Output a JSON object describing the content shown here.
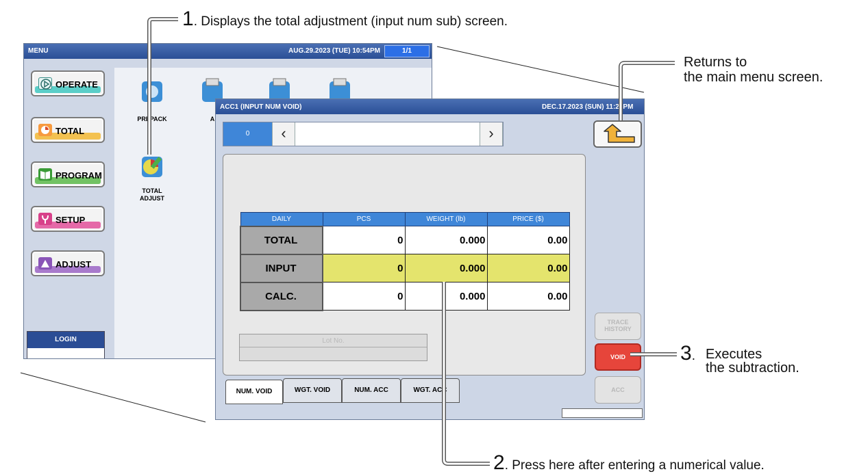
{
  "callouts": {
    "c1_num": "1",
    "c1_text": "Displays the total adjustment (input num sub) screen.",
    "c2_num": "2",
    "c2_text": "Press here after entering a numerical value.",
    "c3_num": "3",
    "c3_line1": "Executes",
    "c3_line2": "the subtraction.",
    "back_line1": "Returns to",
    "back_line2": "the main menu screen."
  },
  "menu_screen": {
    "title": "MENU",
    "date": "AUG.29.2023 (TUE)  10:54PM",
    "page": "1/1",
    "buttons": [
      {
        "label": "OPERATE",
        "color": "#3fc7c0"
      },
      {
        "label": "TOTAL",
        "color": "#f2b733"
      },
      {
        "label": "PROGRAM",
        "color": "#5ab84a"
      },
      {
        "label": "SETUP",
        "color": "#e2509a"
      },
      {
        "label": "ADJUST",
        "color": "#9a64c4"
      }
    ],
    "login_label": "LOGIN",
    "grid": {
      "prepack_label": "PREPACK",
      "acc_label": "A",
      "total_adjust_label_1": "TOTAL",
      "total_adjust_label_2": "ADJUST"
    }
  },
  "acc_screen": {
    "title": "ACC1 (INPUT NUM VOID)",
    "date": "DEC.17.2023 (SUN)  11:28PM",
    "index": "0",
    "columns": [
      "DAILY",
      "PCS",
      "WEIGHT (lb)",
      "PRICE ($)"
    ],
    "rows": [
      {
        "label": "TOTAL",
        "pcs": "0",
        "weight": "0.000",
        "price": "0.00"
      },
      {
        "label": "INPUT",
        "pcs": "0",
        "weight": "0.000",
        "price": "0.00"
      },
      {
        "label": "CALC.",
        "pcs": "0",
        "weight": "0.000",
        "price": "0.00"
      }
    ],
    "lot_label": "Lot No.",
    "tabs": [
      "NUM. VOID",
      "WGT. VOID",
      "NUM. ACC",
      "WGT. ACC"
    ],
    "side_buttons": {
      "trace_1": "TRACE",
      "trace_2": "HISTORY",
      "void": "VOID",
      "acc": "ACC"
    }
  }
}
